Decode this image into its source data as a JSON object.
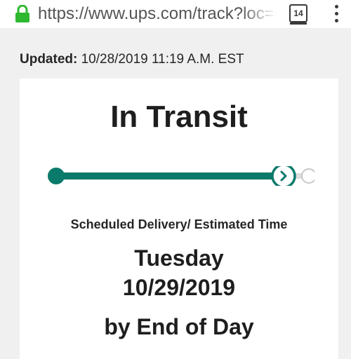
{
  "browser": {
    "url": "https://www.ups.com/track?loc=en",
    "tab_count": "14",
    "lock_icon": "lock-icon",
    "menu_icon": "more-vert-icon"
  },
  "tracking": {
    "updated_label": "Updated:",
    "updated_value": "10/28/2019 11:19 A.M. EST",
    "status": "In Transit",
    "progress": 0.9,
    "colors": {
      "progress": "#0a7a6b",
      "lock": "#2eb82e"
    },
    "scheduled_label": "Scheduled Delivery/ Estimated Time",
    "delivery_day": "Tuesday",
    "delivery_date": "10/29/2019",
    "delivery_time": "by End of Day"
  }
}
